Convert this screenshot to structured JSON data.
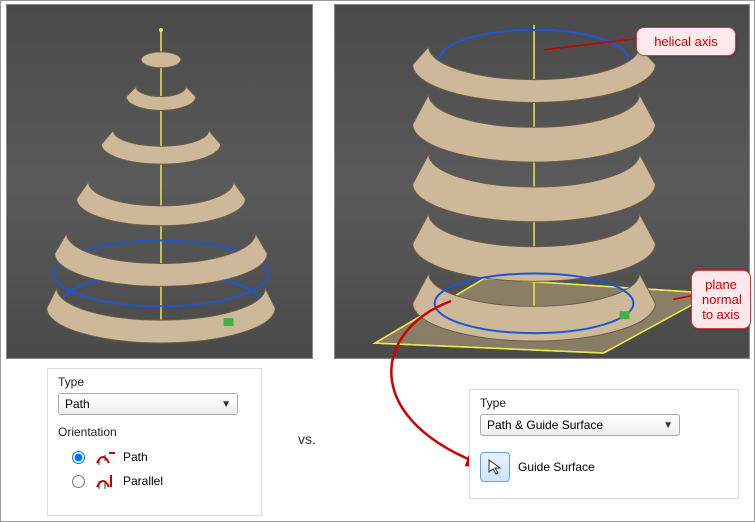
{
  "panels": {
    "left": {
      "type_label": "Type",
      "type_value": "Path",
      "orientation_label": "Orientation",
      "options": {
        "path": "Path",
        "parallel": "Parallel"
      }
    },
    "right": {
      "type_label": "Type",
      "type_value": "Path & Guide Surface",
      "guide_surface_label": "Guide Surface"
    }
  },
  "comparison_label": "vs.",
  "callouts": {
    "helical_axis": "helical axis",
    "plane_normal": "plane normal to axis"
  },
  "colors": {
    "highlight": "#d00000",
    "spiral_fill": "#cdb899",
    "spiral_edge": "#6b5c44",
    "guide_blue": "#1a57d6",
    "axis_yellow": "#e8e84a"
  }
}
